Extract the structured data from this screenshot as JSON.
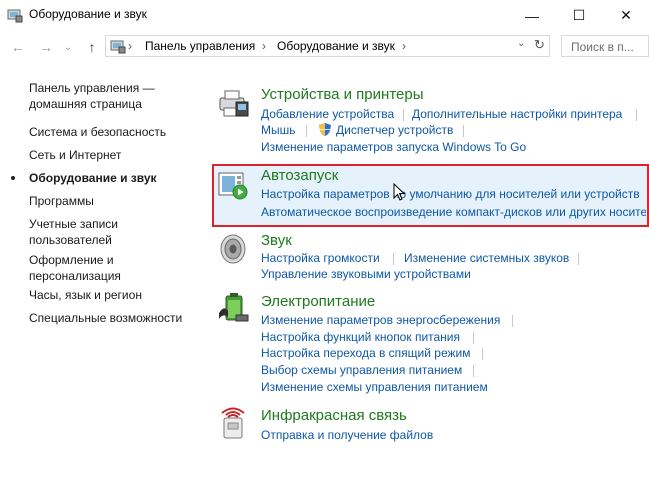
{
  "window": {
    "title": "Оборудование и звук",
    "min_glyph": "—",
    "max_glyph": "☐",
    "close_glyph": "✕"
  },
  "address": {
    "crumbs": [
      "Панель управления",
      "Оборудование и звук"
    ],
    "separator": "›",
    "search_placeholder": "Поиск в п..."
  },
  "sidebar": {
    "items": [
      {
        "label": "Панель управления —\nдомашняя страница"
      },
      {
        "label": "Система и безопасность"
      },
      {
        "label": "Сеть и Интернет"
      },
      {
        "label": "Оборудование и звук",
        "current": true
      },
      {
        "label": "Программы"
      },
      {
        "label": "Учетные записи\nпользователей"
      },
      {
        "label": "Оформление и\nперсонализация"
      },
      {
        "label": "Часы, язык и регион"
      },
      {
        "label": "Специальные возможности"
      }
    ]
  },
  "sections": {
    "devices": {
      "title": "Устройства и принтеры",
      "links": [
        "Добавление устройства",
        "Дополнительные настройки принтера",
        "Мышь",
        "Диспетчер устройств",
        "Изменение параметров запуска Windows To Go"
      ]
    },
    "autoplay": {
      "title": "Автозапуск",
      "links": [
        "Настройка параметров по умолчанию для носителей или устройств",
        "Автоматическое воспроизведение компакт-дисков или других носителей"
      ]
    },
    "sound": {
      "title": "Звук",
      "links": [
        "Настройка громкости",
        "Изменение системных звуков",
        "Управление звуковыми устройствами"
      ]
    },
    "power": {
      "title": "Электропитание",
      "links": [
        "Изменение параметров энергосбережения",
        "Настройка функций кнопок питания",
        "Настройка перехода в спящий режим",
        "Выбор схемы управления питанием",
        "Изменение схемы управления питанием"
      ]
    },
    "infrared": {
      "title": "Инфракрасная связь",
      "links": [
        "Отправка и получение файлов"
      ]
    }
  },
  "colors": {
    "heading": "#1e7a1e",
    "link": "#0f58a5",
    "highlight_border": "#d9242d",
    "highlight_bg": "#e5f1fb"
  }
}
